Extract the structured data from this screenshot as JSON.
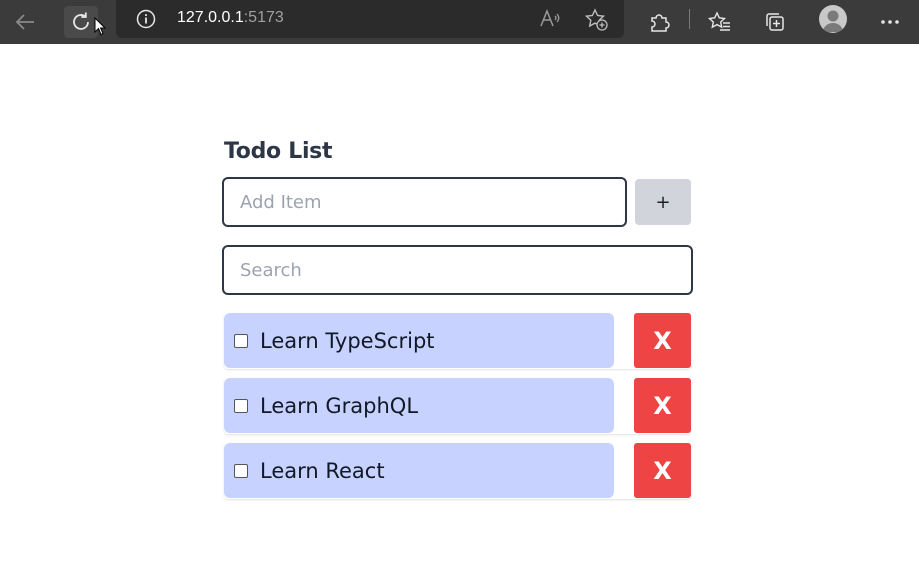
{
  "browser": {
    "url_host": "127.0.0.1",
    "url_port": ":5173",
    "icons": [
      "back-arrow-icon",
      "reload-icon",
      "info-icon",
      "read-aloud-icon",
      "add-favorite-icon",
      "extensions-icon",
      "favorites-icon",
      "collections-icon",
      "profile-icon",
      "more-icon"
    ]
  },
  "app": {
    "title": "Todo List",
    "add_placeholder": "Add Item",
    "add_value": "",
    "add_button_label": "+",
    "search_placeholder": "Search",
    "search_value": "",
    "todos": [
      {
        "label": "Learn TypeScript",
        "checked": false,
        "delete_label": "X"
      },
      {
        "label": "Learn GraphQL",
        "checked": false,
        "delete_label": "X"
      },
      {
        "label": "Learn React",
        "checked": false,
        "delete_label": "X"
      }
    ]
  },
  "colors": {
    "item_background": "#c7d2fe",
    "delete_button": "#ef4444",
    "add_button": "#d1d5db",
    "input_border": "#2d3748"
  }
}
